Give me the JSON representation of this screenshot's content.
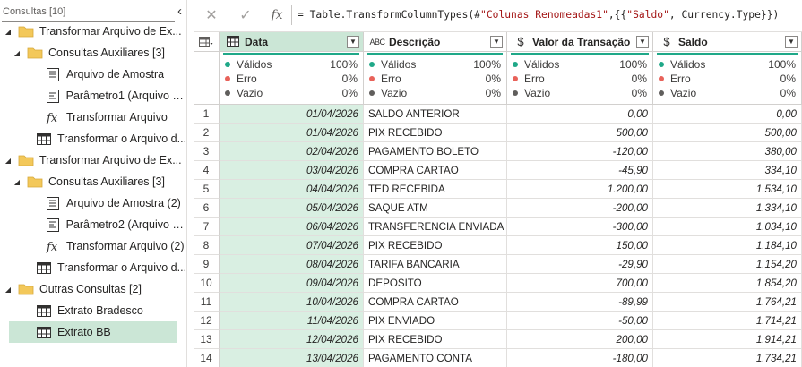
{
  "queries_pane": {
    "title": "Consultas [10]",
    "collapse_glyph": "‹",
    "items": [
      {
        "label": "Transformar Arquivo de Ex...",
        "icon": "folder-icon",
        "level": 0,
        "expanded": true
      },
      {
        "label": "Consultas Auxiliares [3]",
        "icon": "folder-icon",
        "level": 1,
        "expanded": true
      },
      {
        "label": "Arquivo de Amostra",
        "icon": "table-list-icon",
        "level": 2
      },
      {
        "label": "Parâmetro1 (Arquivo d...",
        "icon": "parameter-icon",
        "level": 2
      },
      {
        "label": "Transformar Arquivo",
        "icon": "function-icon",
        "level": 2
      },
      {
        "label": "Transformar o Arquivo d...",
        "icon": "table-icon",
        "level": 1
      },
      {
        "label": "Transformar Arquivo de Ex...",
        "icon": "folder-icon",
        "level": 0,
        "expanded": true
      },
      {
        "label": "Consultas Auxiliares [3]",
        "icon": "folder-icon",
        "level": 1,
        "expanded": true
      },
      {
        "label": "Arquivo de Amostra (2)",
        "icon": "table-list-icon",
        "level": 2
      },
      {
        "label": "Parâmetro2 (Arquivo d...",
        "icon": "parameter-icon",
        "level": 2
      },
      {
        "label": "Transformar Arquivo (2)",
        "icon": "function-icon",
        "level": 2
      },
      {
        "label": "Transformar o Arquivo d...",
        "icon": "table-icon",
        "level": 1
      },
      {
        "label": "Outras Consultas [2]",
        "icon": "folder-icon",
        "level": 0,
        "expanded": true
      },
      {
        "label": "Extrato Bradesco",
        "icon": "table-icon",
        "level": 1
      },
      {
        "label": "Extrato BB",
        "icon": "table-icon",
        "level": 1,
        "selected": true
      }
    ]
  },
  "formula_bar": {
    "cancel_glyph": "✕",
    "confirm_glyph": "✓",
    "fx_glyph": "fx",
    "prefix": "= Table.TransformColumnTypes(#",
    "step_name": "\"Colunas Renomeadas1\"",
    "middle": ",{{",
    "col_name": "\"Saldo\"",
    "suffix": ", Currency.Type}})"
  },
  "grid": {
    "accent_color": "#1fa888",
    "quality_labels": {
      "valid": "Válidos",
      "error": "Erro",
      "empty": "Vazio"
    },
    "quality_colors": {
      "valid": "#1fa888",
      "error": "#e8625a",
      "empty": "#605e5c"
    },
    "columns": [
      {
        "name": "Data",
        "type_icon": "calendar-icon",
        "selected": true,
        "quality": {
          "valid": "100%",
          "error": "0%",
          "empty": "0%"
        }
      },
      {
        "name": "Descrição",
        "type_icon": "text-type-icon",
        "type_glyph": "ABC",
        "quality": {
          "valid": "100%",
          "error": "0%",
          "empty": "0%"
        }
      },
      {
        "name": "Valor da Transação",
        "type_icon": "currency-icon",
        "type_glyph": "$",
        "quality": {
          "valid": "100%",
          "error": "0%",
          "empty": "0%"
        }
      },
      {
        "name": "Saldo",
        "type_icon": "currency-icon",
        "type_glyph": "$",
        "quality": {
          "valid": "100%",
          "error": "0%",
          "empty": "0%"
        }
      }
    ],
    "rows": [
      {
        "n": "1",
        "data": "01/04/2026",
        "desc": "SALDO ANTERIOR",
        "valor": "0,00",
        "saldo": "0,00"
      },
      {
        "n": "2",
        "data": "01/04/2026",
        "desc": "PIX RECEBIDO",
        "valor": "500,00",
        "saldo": "500,00"
      },
      {
        "n": "3",
        "data": "02/04/2026",
        "desc": "PAGAMENTO BOLETO",
        "valor": "-120,00",
        "saldo": "380,00"
      },
      {
        "n": "4",
        "data": "03/04/2026",
        "desc": "COMPRA CARTAO",
        "valor": "-45,90",
        "saldo": "334,10"
      },
      {
        "n": "5",
        "data": "04/04/2026",
        "desc": "TED RECEBIDA",
        "valor": "1.200,00",
        "saldo": "1.534,10"
      },
      {
        "n": "6",
        "data": "05/04/2026",
        "desc": "SAQUE ATM",
        "valor": "-200,00",
        "saldo": "1.334,10"
      },
      {
        "n": "7",
        "data": "06/04/2026",
        "desc": "TRANSFERENCIA ENVIADA",
        "valor": "-300,00",
        "saldo": "1.034,10"
      },
      {
        "n": "8",
        "data": "07/04/2026",
        "desc": "PIX RECEBIDO",
        "valor": "150,00",
        "saldo": "1.184,10"
      },
      {
        "n": "9",
        "data": "08/04/2026",
        "desc": "TARIFA BANCARIA",
        "valor": "-29,90",
        "saldo": "1.154,20"
      },
      {
        "n": "10",
        "data": "09/04/2026",
        "desc": "DEPOSITO",
        "valor": "700,00",
        "saldo": "1.854,20"
      },
      {
        "n": "11",
        "data": "10/04/2026",
        "desc": "COMPRA CARTAO",
        "valor": "-89,99",
        "saldo": "1.764,21"
      },
      {
        "n": "12",
        "data": "11/04/2026",
        "desc": "PIX ENVIADO",
        "valor": "-50,00",
        "saldo": "1.714,21"
      },
      {
        "n": "13",
        "data": "12/04/2026",
        "desc": "PIX RECEBIDO",
        "valor": "200,00",
        "saldo": "1.914,21"
      },
      {
        "n": "14",
        "data": "13/04/2026",
        "desc": "PAGAMENTO CONTA",
        "valor": "-180,00",
        "saldo": "1.734,21"
      }
    ]
  }
}
